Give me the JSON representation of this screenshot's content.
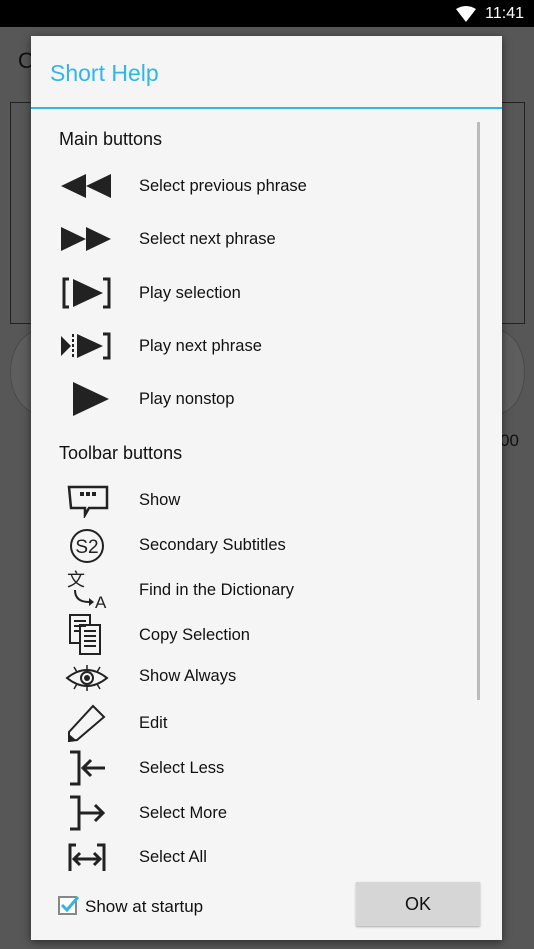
{
  "status_bar": {
    "time": "11:41"
  },
  "background": {
    "left_text": "O",
    "right_text": "00"
  },
  "dialog": {
    "title": "Short Help",
    "main_section": "Main buttons",
    "main_items": [
      {
        "icon": "previous-phrase-icon",
        "label": "Select previous phrase"
      },
      {
        "icon": "next-phrase-icon",
        "label": "Select next phrase"
      },
      {
        "icon": "play-selection-icon",
        "label": "Play selection"
      },
      {
        "icon": "play-next-phrase-icon",
        "label": "Play next phrase"
      },
      {
        "icon": "play-icon",
        "label": "Play nonstop"
      }
    ],
    "toolbar_section": "Toolbar buttons",
    "toolbar_items": [
      {
        "icon": "speech-bubble-icon",
        "label": "Show"
      },
      {
        "icon": "s2-icon",
        "label": "Secondary Subtitles"
      },
      {
        "icon": "translate-icon",
        "label": "Find in the Dictionary"
      },
      {
        "icon": "copy-icon",
        "label": "Copy Selection"
      },
      {
        "icon": "eye-icon",
        "label": "Show Always"
      },
      {
        "icon": "pencil-icon",
        "label": "Edit"
      },
      {
        "icon": "select-less-icon",
        "label": "Select Less"
      },
      {
        "icon": "select-more-icon",
        "label": "Select More"
      },
      {
        "icon": "select-all-icon",
        "label": "Select All"
      }
    ],
    "show_at_startup": {
      "label": "Show at startup",
      "checked": true
    },
    "ok_label": "OK",
    "accent": "#33b5e5"
  }
}
